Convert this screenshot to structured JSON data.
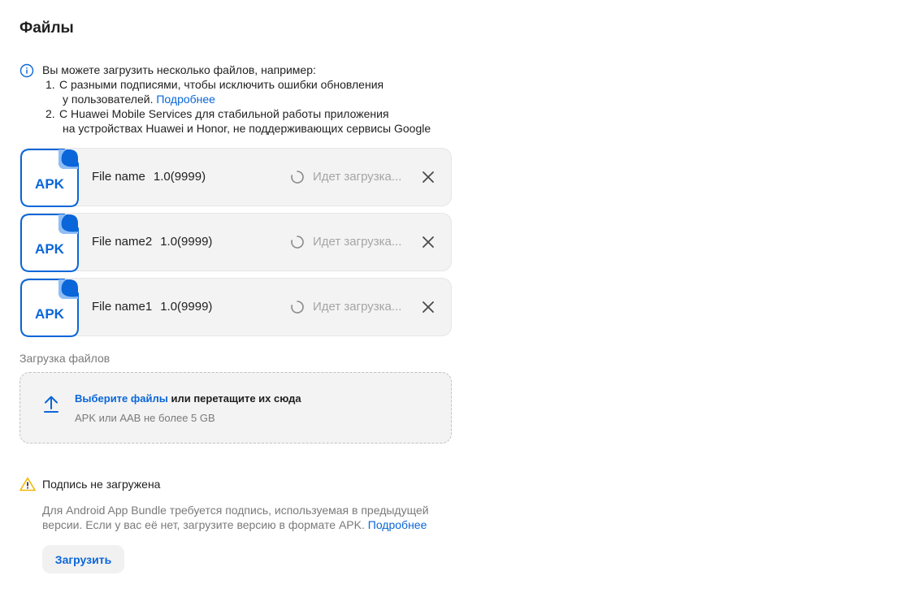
{
  "page": {
    "title": "Файлы"
  },
  "info": {
    "intro": "Вы можете загрузить несколько файлов, например:",
    "items": [
      {
        "num": "1.",
        "line1": "С разными подписями, чтобы исключить ошибки обновления",
        "line2": "у пользователей.",
        "link": "Подробнее"
      },
      {
        "num": "2.",
        "line1": "С Huawei Mobile Services для стабильной работы приложения",
        "line2": "на устройствах Huawei и Honor, не поддерживающих сервисы Google"
      }
    ]
  },
  "files": [
    {
      "icon_label": "APK",
      "name": "File name",
      "version": "1.0(9999)",
      "status": "Идет загрузка..."
    },
    {
      "icon_label": "APK",
      "name": "File name2",
      "version": "1.0(9999)",
      "status": "Идет загрузка..."
    },
    {
      "icon_label": "APK",
      "name": "File name1",
      "version": "1.0(9999)",
      "status": "Идет загрузка..."
    }
  ],
  "upload": {
    "label": "Загрузка файлов",
    "link": "Выберите файлы",
    "text": " или перетащите их сюда",
    "hint": "APK или AAB не более 5 GB"
  },
  "warning": {
    "title": "Подпись не загружена",
    "line1": "Для Android App Bundle требуется подпись, используемая в предыдущей",
    "line2": "версии. Если у вас её нет, загрузите версию в формате APK.",
    "link": "Подробнее",
    "button": "Загрузить"
  },
  "colors": {
    "accent": "#0a66d9",
    "warning": "#f2b705",
    "apk_blue": "#0a66d9"
  },
  "icons": {
    "info": "info-icon",
    "warning": "warning-icon",
    "upload": "upload-icon",
    "spinner": "spinner-icon",
    "close": "close-icon",
    "file": "apk-file-icon"
  }
}
